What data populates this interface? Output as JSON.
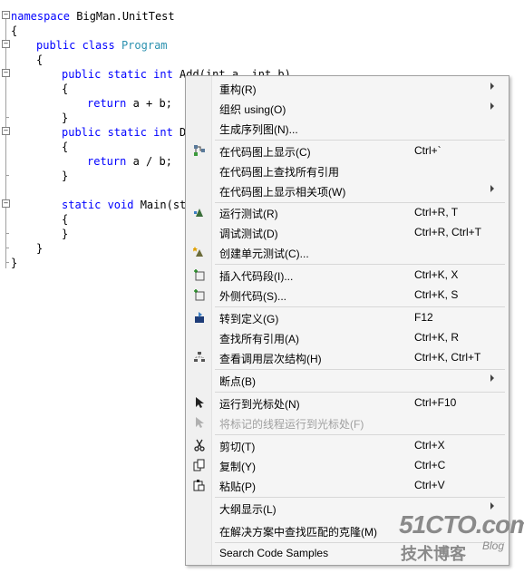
{
  "code": {
    "l1_kw": "namespace",
    "l1_name": " BigMan.UnitTest",
    "l2": "{",
    "l3_kw1": "public",
    "l3_kw2": " class",
    "l3_type": " Program",
    "l4": "{",
    "l5_kw": "public static int",
    "l5_rest": " Add(int a, int b)",
    "l6": "{",
    "l7_kw": "return",
    "l7_rest": " a + b;",
    "l8": "}",
    "l9_kw": "public static int",
    "l9_rest": " Div",
    "l10": "{",
    "l11_kw": "return",
    "l11_rest": " a / b;",
    "l12": "}",
    "l13_kw": "static void",
    "l13_rest": " Main(str",
    "l14": "{",
    "l15": "}",
    "l16": "}",
    "l17": "}"
  },
  "menu": {
    "refactor": {
      "label": "重构(R)"
    },
    "organize_using": {
      "label": "组织 using(O)"
    },
    "gen_sequence": {
      "label": "生成序列图(N)..."
    },
    "show_on_codemap": {
      "label": "在代码图上显示(C)",
      "shortcut": "Ctrl+`"
    },
    "find_all_refs_codemap": {
      "label": "在代码图上查找所有引用"
    },
    "show_related_codemap": {
      "label": "在代码图上显示相关项(W)"
    },
    "run_tests": {
      "label": "运行测试(R)",
      "shortcut": "Ctrl+R, T"
    },
    "debug_tests": {
      "label": "调试测试(D)",
      "shortcut": "Ctrl+R, Ctrl+T"
    },
    "create_unit_tests": {
      "label": "创建单元测试(C)..."
    },
    "insert_snippet": {
      "label": "插入代码段(I)...",
      "shortcut": "Ctrl+K, X"
    },
    "surround_with": {
      "label": "外侧代码(S)...",
      "shortcut": "Ctrl+K, S"
    },
    "goto_definition": {
      "label": "转到定义(G)",
      "shortcut": "F12"
    },
    "find_all_refs": {
      "label": "查找所有引用(A)",
      "shortcut": "Ctrl+K, R"
    },
    "view_call_hierarchy": {
      "label": "查看调用层次结构(H)",
      "shortcut": "Ctrl+K, Ctrl+T"
    },
    "breakpoint": {
      "label": "断点(B)"
    },
    "run_to_cursor": {
      "label": "运行到光标处(N)",
      "shortcut": "Ctrl+F10"
    },
    "run_flagged_to_cursor": {
      "label": "将标记的线程运行到光标处(F)"
    },
    "cut": {
      "label": "剪切(T)",
      "shortcut": "Ctrl+X"
    },
    "copy": {
      "label": "复制(Y)",
      "shortcut": "Ctrl+C"
    },
    "paste": {
      "label": "粘贴(P)",
      "shortcut": "Ctrl+V"
    },
    "outlining": {
      "label": "大纲显示(L)"
    },
    "find_clones": {
      "label": "在解决方案中查找匹配的克隆(M)"
    },
    "search_samples": {
      "label": "Search Code Samples"
    }
  },
  "watermark": {
    "logo": "51CTO.com",
    "sub": "技术博客",
    "blog": "Blog"
  },
  "colors": {
    "keyword": "#0000ff",
    "type": "#2b91af",
    "menu_bg": "#f5f5f5",
    "disabled": "#a0a0a0"
  }
}
